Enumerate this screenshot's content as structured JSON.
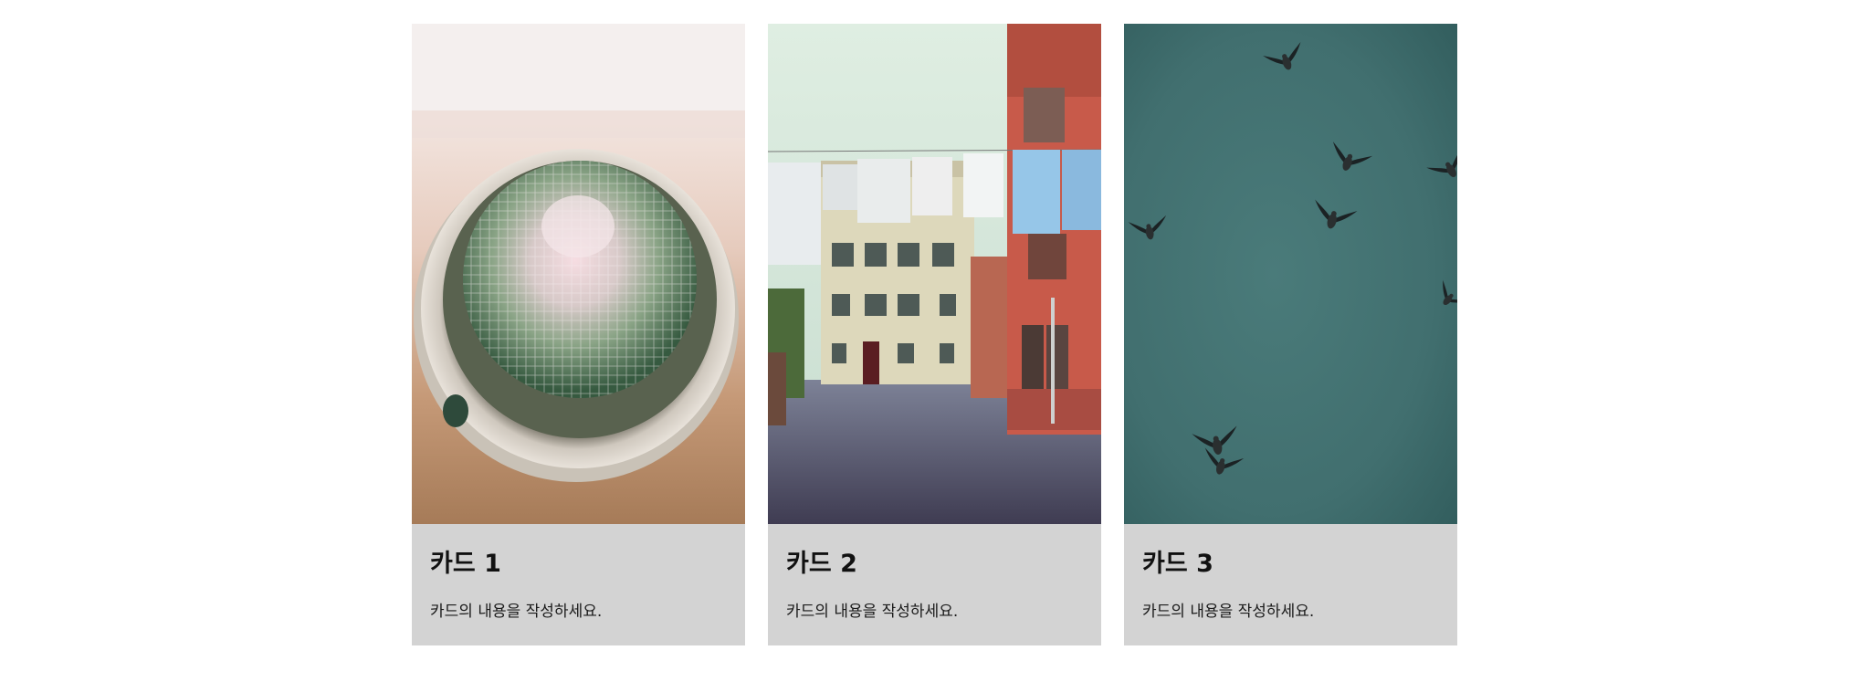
{
  "cards": [
    {
      "title": "카드 1",
      "text": "카드의 내용을 작성하세요.",
      "image": "cactus-photo"
    },
    {
      "title": "카드 2",
      "text": "카드의 내용을 작성하세요.",
      "image": "street-with-laundry-photo"
    },
    {
      "title": "카드 3",
      "text": "카드의 내용을 작성하세요.",
      "image": "birds-in-sky-photo"
    }
  ],
  "colors": {
    "page_background": "#ffffff",
    "card_background": "#d3d3d3",
    "title_text": "#111111",
    "body_text": "#1a1a1a"
  }
}
